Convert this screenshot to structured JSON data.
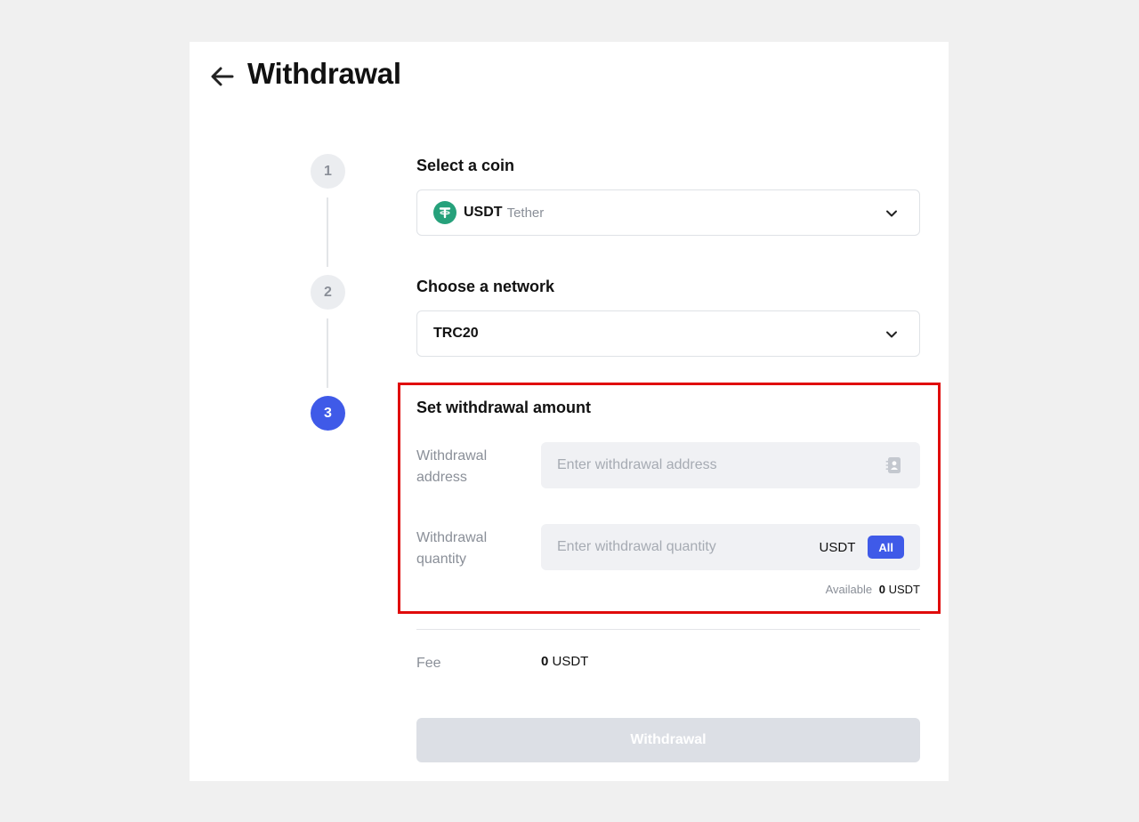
{
  "page": {
    "title": "Withdrawal"
  },
  "steps": [
    {
      "number": "1",
      "title": "Select a coin",
      "state": "done"
    },
    {
      "number": "2",
      "title": "Choose a network",
      "state": "done"
    },
    {
      "number": "3",
      "title": "Set withdrawal amount",
      "state": "active"
    }
  ],
  "coin_select": {
    "symbol": "USDT",
    "name": "Tether",
    "icon": "tether-icon"
  },
  "network_select": {
    "value": "TRC20",
    "icon": "chevron-down-icon"
  },
  "address_field": {
    "label_line1": "Withdrawal",
    "label_line2": "address",
    "placeholder": "Enter withdrawal address",
    "value": "",
    "icon": "address-book-icon"
  },
  "quantity_field": {
    "label_line1": "Withdrawal",
    "label_line2": "quantity",
    "placeholder": "Enter withdrawal quantity",
    "value": "",
    "unit": "USDT",
    "all_label": "All"
  },
  "available": {
    "label": "Available",
    "amount": "0",
    "unit": "USDT"
  },
  "fee": {
    "label": "Fee",
    "amount": "0",
    "unit": "USDT"
  },
  "submit": {
    "label": "Withdrawal",
    "enabled": false
  },
  "colors": {
    "accent": "#3f5ae8",
    "tether": "#26a17b",
    "highlight_border": "#e00b0b",
    "disabled_button": "#dcdfe5"
  }
}
